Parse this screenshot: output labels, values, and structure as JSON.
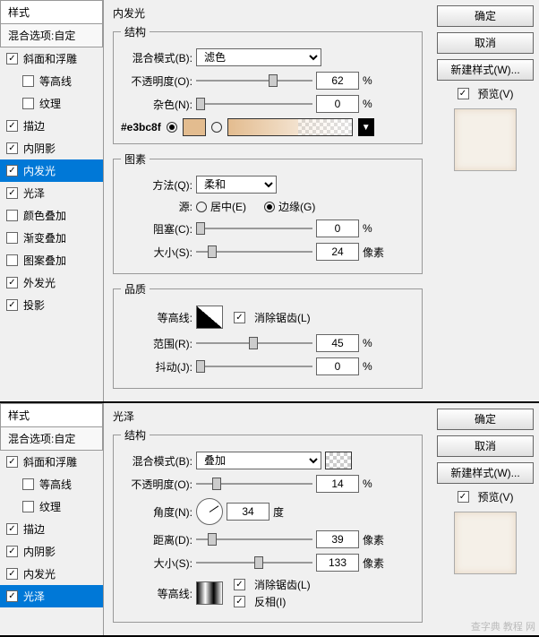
{
  "common": {
    "styles_header": "样式",
    "blend_options": "混合选项:自定",
    "ok": "确定",
    "cancel": "取消",
    "new_style": "新建样式(W)...",
    "preview": "预览(V)"
  },
  "styleList": [
    {
      "label": "斜面和浮雕",
      "checked": true,
      "indent": false
    },
    {
      "label": "等高线",
      "checked": false,
      "indent": true
    },
    {
      "label": "纹理",
      "checked": false,
      "indent": true
    },
    {
      "label": "描边",
      "checked": true,
      "indent": false
    },
    {
      "label": "内阴影",
      "checked": true,
      "indent": false
    },
    {
      "label": "内发光",
      "checked": true,
      "indent": false
    },
    {
      "label": "光泽",
      "checked": true,
      "indent": false
    },
    {
      "label": "颜色叠加",
      "checked": false,
      "indent": false
    },
    {
      "label": "渐变叠加",
      "checked": false,
      "indent": false
    },
    {
      "label": "图案叠加",
      "checked": false,
      "indent": false
    },
    {
      "label": "外发光",
      "checked": true,
      "indent": false
    },
    {
      "label": "投影",
      "checked": true,
      "indent": false
    }
  ],
  "panel1": {
    "title": "内发光",
    "selectedStyle": "内发光",
    "struct": {
      "legend": "结构",
      "blend_label": "混合模式(B):",
      "blend_value": "滤色",
      "opacity_label": "不透明度(O):",
      "opacity_value": "62",
      "noise_label": "杂色(N):",
      "noise_value": "0",
      "percent": "%",
      "hex": "#e3bc8f"
    },
    "elements": {
      "legend": "图素",
      "method_label": "方法(Q):",
      "method_value": "柔和",
      "source_label": "源:",
      "center": "居中(E)",
      "edge": "边缘(G)",
      "choke_label": "阻塞(C):",
      "choke_value": "0",
      "size_label": "大小(S):",
      "size_value": "24",
      "px": "像素",
      "percent": "%"
    },
    "quality": {
      "legend": "品质",
      "contour_label": "等高线:",
      "antialias": "消除锯齿(L)",
      "range_label": "范围(R):",
      "range_value": "45",
      "jitter_label": "抖动(J):",
      "jitter_value": "0",
      "percent": "%"
    }
  },
  "panel2": {
    "title": "光泽",
    "selectedStyle": "光泽",
    "struct": {
      "legend": "结构",
      "blend_label": "混合模式(B):",
      "blend_value": "叠加",
      "opacity_label": "不透明度(O):",
      "opacity_value": "14",
      "angle_label": "角度(N):",
      "angle_value": "34",
      "deg": "度",
      "distance_label": "距离(D):",
      "distance_value": "39",
      "size_label": "大小(S):",
      "size_value": "133",
      "px": "像素",
      "percent": "%",
      "contour_label": "等高线:",
      "antialias": "消除锯齿(L)",
      "invert": "反相(I)"
    }
  },
  "watermark": "查字典  教程 网"
}
